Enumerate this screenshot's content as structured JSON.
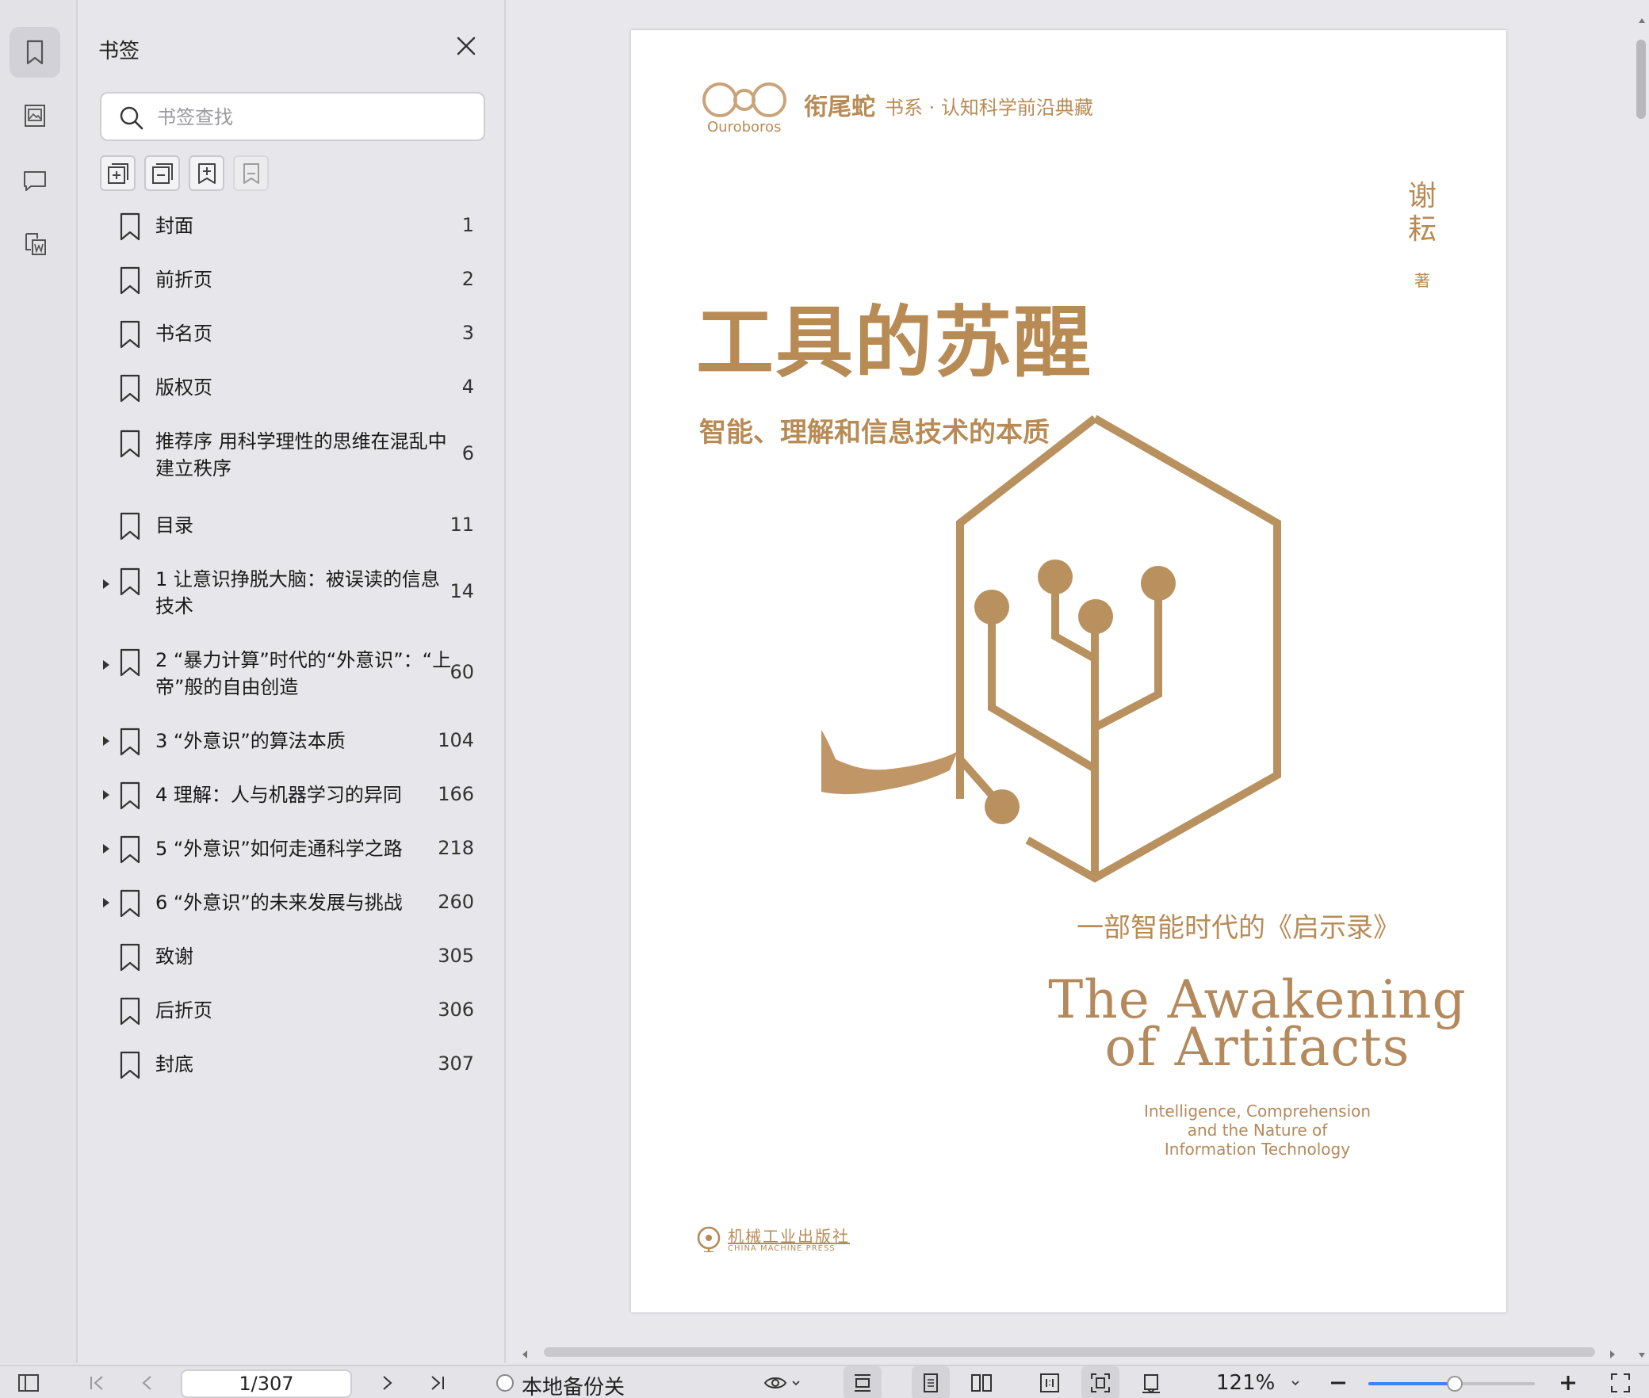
{
  "panel": {
    "title": "书签",
    "search_placeholder": "书签查找"
  },
  "bookmarks": [
    {
      "label": "封面",
      "page": "1",
      "expandable": false
    },
    {
      "label": "前折页",
      "page": "2",
      "expandable": false
    },
    {
      "label": "书名页",
      "page": "3",
      "expandable": false
    },
    {
      "label": "版权页",
      "page": "4",
      "expandable": false
    },
    {
      "label": "推荐序 用科学理性的思维在混乱中建立秩序",
      "page": "6",
      "expandable": false
    },
    {
      "label": "目录",
      "page": "11",
      "expandable": false
    },
    {
      "label": "1 让意识挣脱大脑：被误读的信息技术",
      "page": "14",
      "expandable": true
    },
    {
      "label": "2 “暴力计算”时代的“外意识”：“上帝”般的自由创造",
      "page": "60",
      "expandable": true
    },
    {
      "label": "3 “外意识”的算法本质",
      "page": "104",
      "expandable": true
    },
    {
      "label": "4 理解：人与机器学习的异同",
      "page": "166",
      "expandable": true
    },
    {
      "label": "5 “外意识”如何走通科学之路",
      "page": "218",
      "expandable": true
    },
    {
      "label": "6 “外意识”的未来发展与挑战",
      "page": "260",
      "expandable": true
    },
    {
      "label": "致谢",
      "page": "305",
      "expandable": false
    },
    {
      "label": "后折页",
      "page": "306",
      "expandable": false
    },
    {
      "label": "封底",
      "page": "307",
      "expandable": false
    }
  ],
  "cover": {
    "series_logo_text": "Ouroboros",
    "series_name": "衔尾蛇",
    "series_suffix": "书系 · 认知科学前沿典藏",
    "author_line1": "谢",
    "author_line2": "耘",
    "author_role": "著",
    "title": "工具的苏醒",
    "subtitle": "智能、理解和信息技术的本质",
    "tagline": "一部智能时代的《启示录》",
    "en_title_line1": "The Awakening",
    "en_title_line2": "of Artifacts",
    "en_sub_line1": "Intelligence, Comprehension",
    "en_sub_line2": "and the Nature of",
    "en_sub_line3": "Information Technology",
    "publisher_cn": "机械工业出版社",
    "publisher_en": "CHINA MACHINE PRESS"
  },
  "bottombar": {
    "page_indicator": "1/307",
    "backup_label": "本地备份关",
    "zoom_label": "121%",
    "zoom_fraction": 0.52
  },
  "colors": {
    "accent": "#3b82f6",
    "cover_gold": "#b48a5c"
  }
}
